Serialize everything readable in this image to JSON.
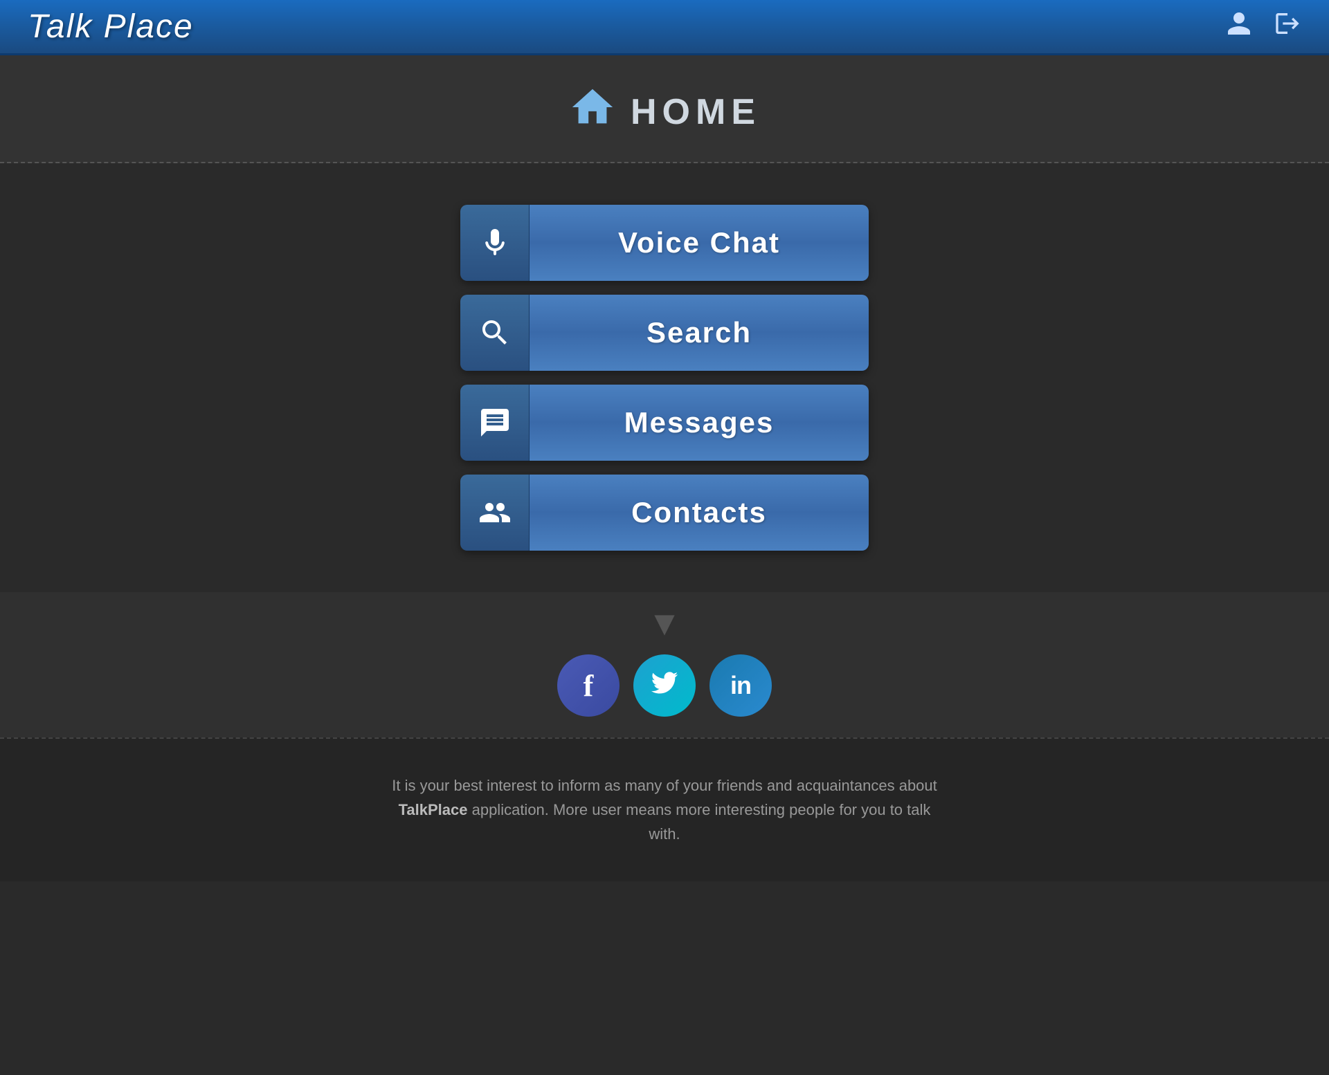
{
  "header": {
    "logo": "Talk Place",
    "user_icon": "👤",
    "logout_icon": "🚪"
  },
  "home": {
    "label": "HOME"
  },
  "nav_buttons": [
    {
      "id": "voice-chat",
      "label": "Voice Chat",
      "icon": "mic"
    },
    {
      "id": "search",
      "label": "Search",
      "icon": "search"
    },
    {
      "id": "messages",
      "label": "Messages",
      "icon": "messages"
    },
    {
      "id": "contacts",
      "label": "Contacts",
      "icon": "contacts"
    }
  ],
  "social": {
    "facebook_label": "f",
    "twitter_label": "🐦",
    "linkedin_label": "in"
  },
  "footer": {
    "text": "It is your best interest to inform as many of your friends and acquaintances about ",
    "brand": "TalkPlace",
    "text2": " application. More user means more interesting people for you to talk with."
  }
}
